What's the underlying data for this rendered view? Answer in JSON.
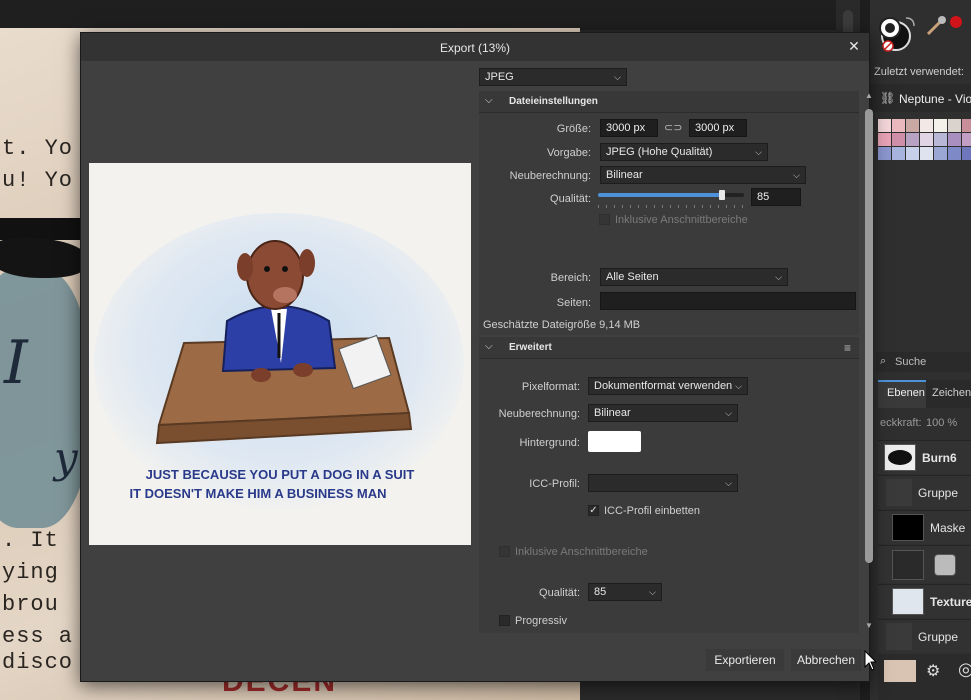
{
  "background": {
    "typewriter_lines": [
      "t. Yo",
      "u! Yo",
      ". It",
      "ying",
      " brou",
      "ess a",
      "disco"
    ],
    "stamp_text": "DECEN",
    "script_letters": [
      "I",
      "y"
    ]
  },
  "right_panel": {
    "recently_used_label": "Zuletzt verwendet:",
    "palette_name": "Neptune - Viol",
    "search_placeholder": "Suche",
    "tabs": [
      {
        "label": "Ebenen"
      },
      {
        "label": "Zeichen"
      }
    ],
    "opacity_label": "eckkraft:",
    "opacity_value": "100 %",
    "swatches": [
      "#f3d6d8",
      "#e9b9bd",
      "#c9a7a2",
      "#f2e9e6",
      "#f4f1ea",
      "#d9d2cd",
      "#c88f9a",
      "#e9a3b7",
      "#cf8fa8",
      "#b7a2c4",
      "#e1d5e5",
      "#b9b7d6",
      "#a98fbf",
      "#c29ec5",
      "#8b97cf",
      "#a7b4de",
      "#c8d1ea",
      "#dfe3f0",
      "#9aa6d4",
      "#7d8ac7",
      "#6f77bc"
    ],
    "layers": [
      {
        "label": "Burn6"
      },
      {
        "label": "Gruppe"
      },
      {
        "label": "Maske"
      },
      {
        "label": ""
      },
      {
        "label": "Texturel"
      },
      {
        "label": "Gruppe"
      }
    ]
  },
  "dialog": {
    "title": "Export (13%)",
    "format_value": "JPEG",
    "file_settings": {
      "section_title": "Dateieinstellungen",
      "size_label": "Größe:",
      "width_value": "3000 px",
      "height_value": "3000 px",
      "preset_label": "Vorgabe:",
      "preset_value": "JPEG (Hohe Qualität)",
      "resample_label": "Neuberechnung:",
      "resample_value": "Bilinear",
      "quality_label": "Qualität:",
      "quality_value": "85",
      "quality_percent": 85,
      "include_bleed_label": "Inklusive Anschnittbereiche",
      "area_label": "Bereich:",
      "area_value": "Alle Seiten",
      "pages_label": "Seiten:",
      "pages_value": "",
      "estimated_size": "Geschätzte Dateigröße 9,14 MB"
    },
    "advanced": {
      "section_title": "Erweitert",
      "pixel_format_label": "Pixelformat:",
      "pixel_format_value": "Dokumentformat verwenden",
      "resample_label": "Neuberechnung:",
      "resample_value": "Bilinear",
      "background_label": "Hintergrund:",
      "background_color": "#ffffff",
      "icc_profile_label": "ICC-Profil:",
      "icc_profile_value": "",
      "embed_icc_label": "ICC-Profil einbetten",
      "embed_icc_checked": true,
      "include_bleed_label": "Inklusive Anschnittbereiche",
      "quality_label": "Qualität:",
      "quality_value": "85",
      "progressive_label": "Progressiv",
      "progressive_checked": false
    },
    "preview": {
      "caption_line1": "JUST BECAUSE YOU PUT A DOG IN A SUIT",
      "caption_line2": "IT DOESN'T MAKE HIM A BUSINESS MAN"
    },
    "buttons": {
      "export_label": "Exportieren",
      "cancel_label": "Abbrechen"
    }
  },
  "colors": {
    "accent": "#4d92d8",
    "dialog_bg": "#404040",
    "caption_ink": "#2a3a8a"
  }
}
